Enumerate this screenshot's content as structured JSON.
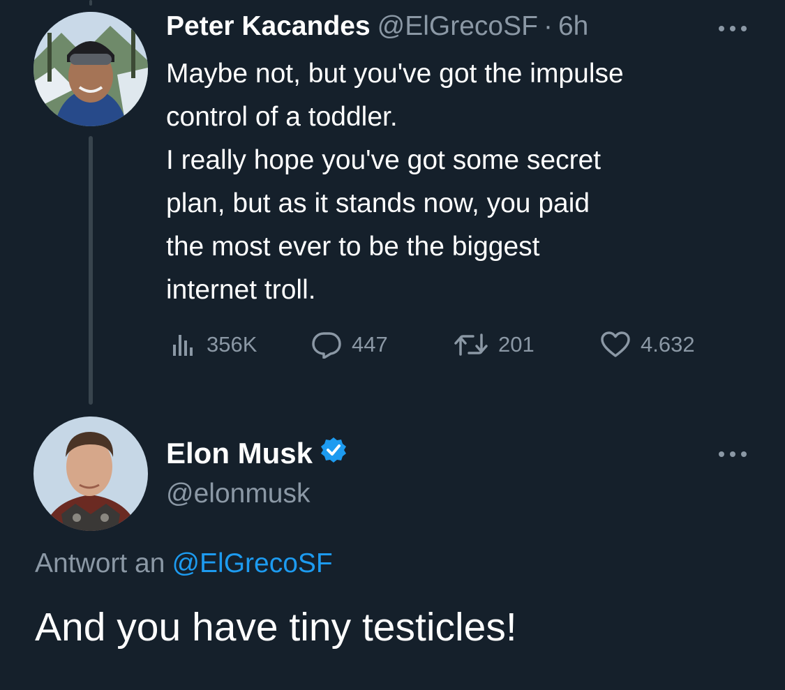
{
  "tweet1": {
    "author_name": "Peter Kacandes",
    "author_handle": "@ElGrecoSF",
    "separator": "·",
    "time": "6h",
    "body_lines": [
      "Maybe not, but you've got the impulse",
      "control of a toddler.",
      "I really hope you've got some secret",
      "plan, but as it stands now, you paid",
      "the most ever to be the biggest",
      "internet troll."
    ],
    "stats": {
      "views": "356K",
      "replies": "447",
      "retweets": "201",
      "likes": "4.632"
    }
  },
  "tweet2": {
    "author_name": "Elon Musk",
    "author_handle": "@elonmusk",
    "reply_prefix": "Antwort an",
    "reply_mention": "@ElGrecoSF",
    "body": "And you have tiny testicles!"
  },
  "colors": {
    "background": "#15202b",
    "text_primary": "#ffffff",
    "text_secondary": "#8b98a5",
    "accent_blue": "#1d9bf0",
    "thread_line": "#38444d"
  },
  "icons": {
    "more": "more-horizontal-icon",
    "views": "analytics-icon",
    "reply": "reply-icon",
    "retweet": "retweet-icon",
    "like": "heart-icon",
    "verified": "verified-badge-icon"
  }
}
